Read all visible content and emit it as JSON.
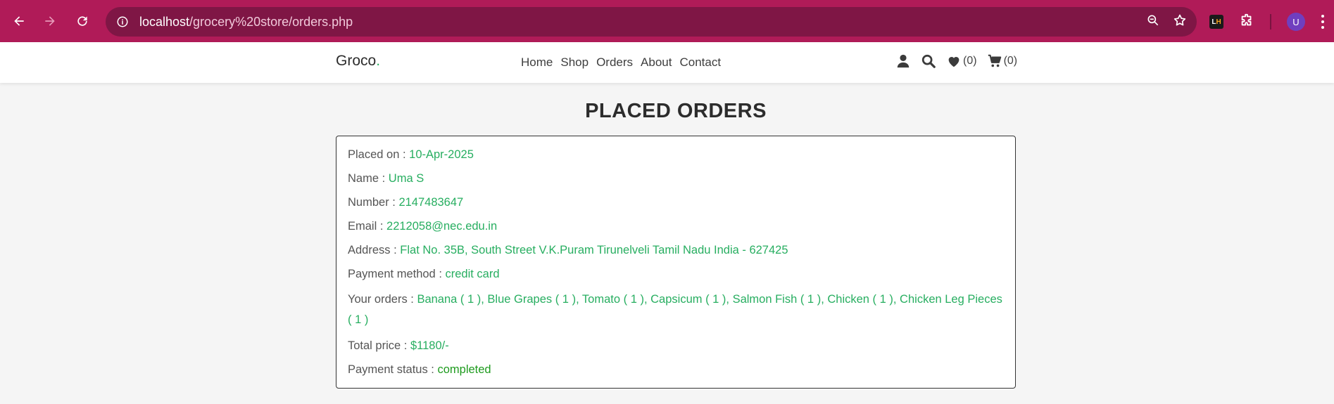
{
  "browser": {
    "url_host": "localhost",
    "url_path": "/grocery%20store/orders.php",
    "extension_label_l": "L",
    "extension_label_h": "H",
    "avatar_letter": "U"
  },
  "header": {
    "logo": "Groco",
    "logo_dot": ".",
    "nav": [
      "Home",
      "Shop",
      "Orders",
      "About",
      "Contact"
    ],
    "wishlist_count": "(0)",
    "cart_count": "(0)"
  },
  "page": {
    "title": "PLACED ORDERS"
  },
  "order": {
    "placed_on_label": "Placed on : ",
    "placed_on": "10-Apr-2025",
    "name_label": "Name : ",
    "name": "Uma S",
    "number_label": "Number : ",
    "number": "2147483647",
    "email_label": "Email : ",
    "email": "2212058@nec.edu.in",
    "address_label": "Address : ",
    "address": "Flat No. 35B, South Street V.K.Puram Tirunelveli Tamil Nadu India - 627425",
    "payment_method_label": "Payment method : ",
    "payment_method": "credit card",
    "orders_label": "Your orders : ",
    "orders": "Banana ( 1 ), Blue Grapes ( 1 ), Tomato ( 1 ), Capsicum ( 1 ), Salmon Fish ( 1 ), Chicken ( 1 ), Chicken Leg Pieces ( 1 )",
    "total_label": "Total price : ",
    "total": "$1180/-",
    "status_label": "Payment status : ",
    "status": "completed"
  },
  "colors": {
    "browser_bar": "#b01b58",
    "omnibox": "#7f1645",
    "accent_green": "#27ae60",
    "status_green": "#1e9b1e"
  },
  "icons": {
    "back": "arrow-left-icon",
    "forward": "arrow-right-icon",
    "reload": "reload-icon",
    "info": "info-icon",
    "zoom": "zoom-out-icon",
    "bookmark": "star-icon",
    "extensions": "puzzle-icon",
    "user": "user-icon",
    "search": "search-icon",
    "wishlist": "heart-icon",
    "cart": "cart-icon"
  }
}
